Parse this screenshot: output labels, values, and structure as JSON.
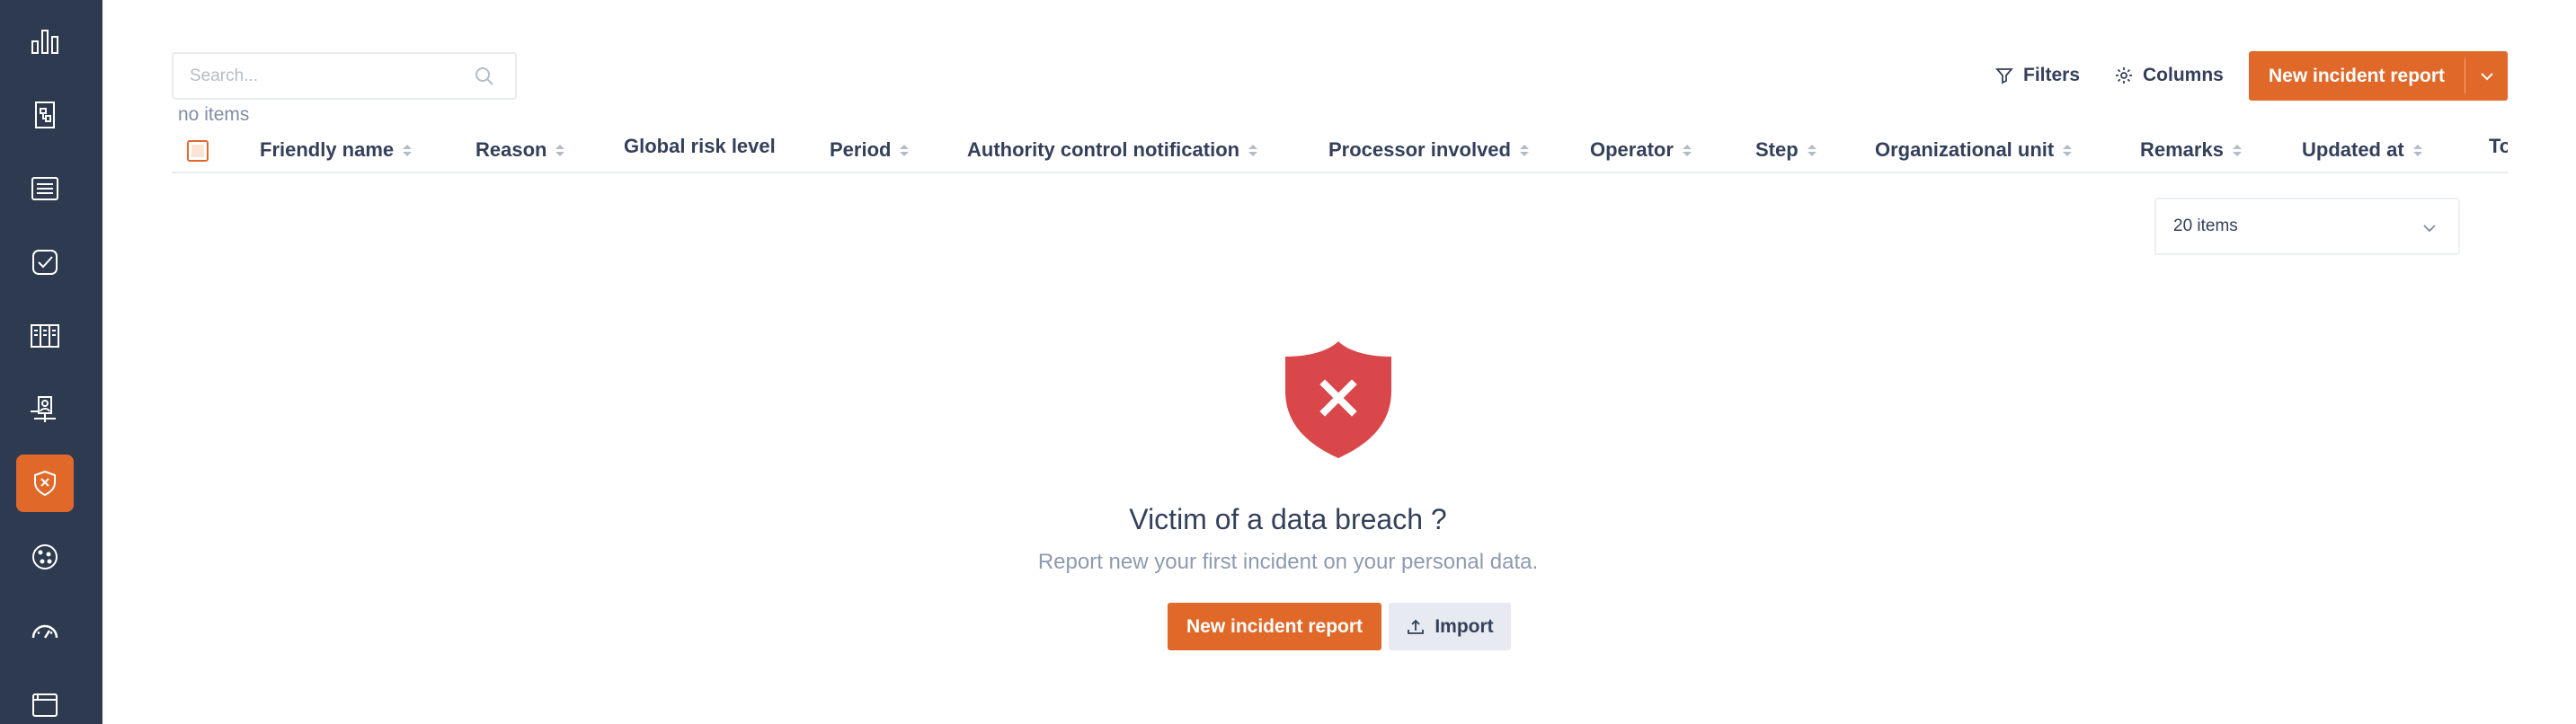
{
  "colors": {
    "sidebar": "#2d3a4f",
    "accent": "#e0692a",
    "text": "#34405a",
    "muted": "#8d9ab0",
    "danger": "#d9474b"
  },
  "sidebar": {
    "items": [
      {
        "icon": "bar-chart-icon",
        "active": false
      },
      {
        "icon": "document-flow-icon",
        "active": false
      },
      {
        "icon": "list-icon",
        "active": false
      },
      {
        "icon": "check-shield-icon",
        "active": false
      },
      {
        "icon": "columns-table-icon",
        "active": false
      },
      {
        "icon": "user-tree-icon",
        "active": false
      },
      {
        "icon": "shield-x-icon",
        "active": true
      },
      {
        "icon": "cookie-icon",
        "active": false
      },
      {
        "icon": "gauge-icon",
        "active": false
      },
      {
        "icon": "window-icon",
        "active": false
      }
    ]
  },
  "search": {
    "placeholder": "Search..."
  },
  "status": {
    "count_text": "no items"
  },
  "toolbar": {
    "filters_label": "Filters",
    "columns_label": "Columns",
    "new_report_label": "New incident report"
  },
  "table": {
    "columns": [
      {
        "label": "Friendly name",
        "sortable": true
      },
      {
        "label": "Reason",
        "sortable": true
      },
      {
        "label": "Global risk level",
        "sortable": false
      },
      {
        "label": "Period",
        "sortable": true
      },
      {
        "label": "Authority control notification",
        "sortable": true
      },
      {
        "label": "Processor involved",
        "sortable": true
      },
      {
        "label": "Operator",
        "sortable": true
      },
      {
        "label": "Step",
        "sortable": true
      },
      {
        "label": "Organizational unit",
        "sortable": true
      },
      {
        "label": "Remarks",
        "sortable": true
      },
      {
        "label": "Updated at",
        "sortable": true
      },
      {
        "label": "To",
        "sortable": false
      }
    ]
  },
  "pagination": {
    "page_size_label": "20 items"
  },
  "empty_state": {
    "icon": "shield-x-icon",
    "title": "Victim of a data breach ?",
    "subtitle": "Report new your first incident on your personal data.",
    "new_report_label": "New incident report",
    "import_label": "Import"
  }
}
